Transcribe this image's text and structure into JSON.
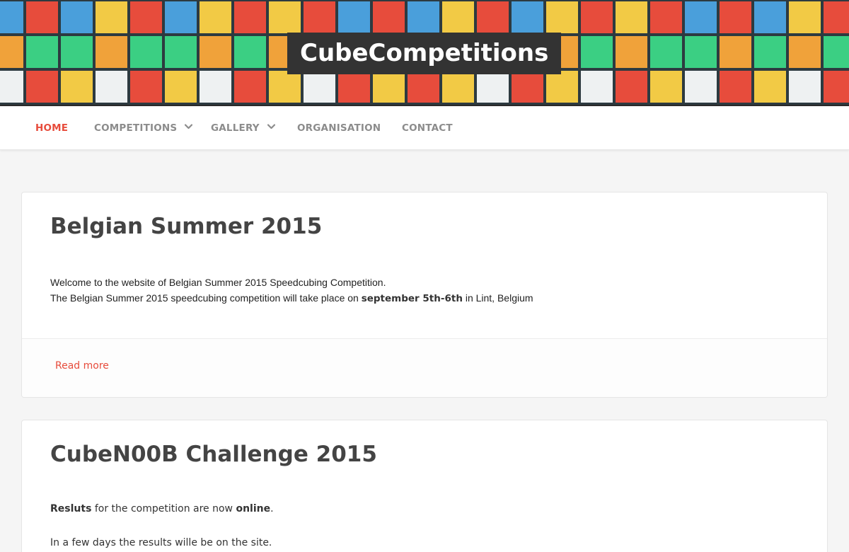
{
  "site": {
    "title": "CubeCompetitions"
  },
  "colors": {
    "accent": "#e74c3c",
    "red": "#e74c3c",
    "blue": "#4a9fdb",
    "yellow": "#f2ca45",
    "green": "#3bcf83",
    "orange": "#f0a23a",
    "white": "#eef1f2"
  },
  "nav": {
    "home": "HOME",
    "competitions": "COMPETITIONS",
    "gallery": "GALLERY",
    "organisation": "ORGANISATION",
    "contact": "CONTACT"
  },
  "posts": [
    {
      "title": "Belgian Summer 2015",
      "line1": "Welcome to the website of Belgian Summer 2015 Speedcubing Competition.",
      "line2_prefix": "The Belgian Summer 2015 speedcubing competition will take place on ",
      "line2_bold": "september 5th-6th",
      "line2_suffix": " in Lint, Belgium",
      "read_more": "Read more"
    },
    {
      "title": "CubeN00B Challenge 2015",
      "p1_bold1": "Resluts",
      "p1_mid": " for the competition are now ",
      "p1_bold2": "online",
      "p1_end": ".",
      "p2": "In a few days the results wille be on the site."
    }
  ]
}
